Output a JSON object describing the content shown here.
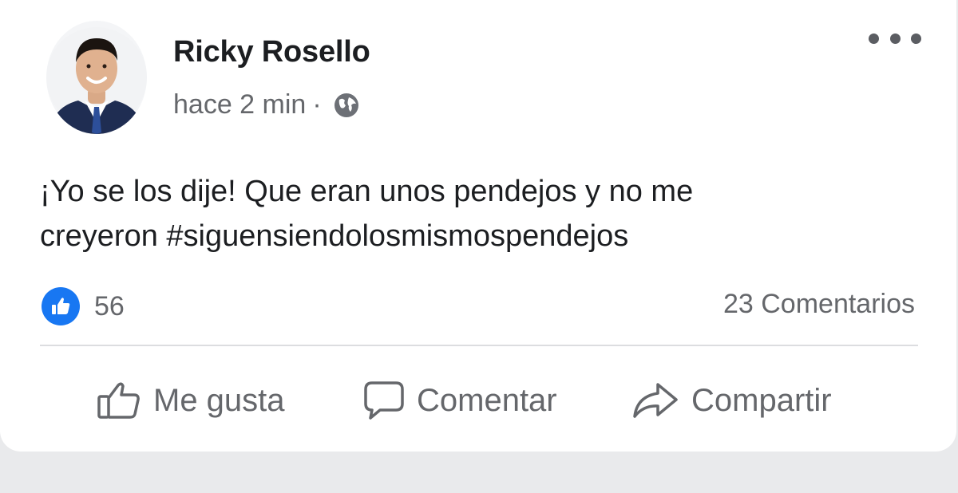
{
  "post": {
    "author": "Ricky Rosello",
    "time": "hace 2 min",
    "separator": "·",
    "visibility_icon": "globe-icon",
    "text": "¡Yo se los dije!  Que eran unos pendejos y no me\ncreyeron #siguensiendolosmismospendejos",
    "reactions": {
      "icon": "like-icon",
      "count": "56"
    },
    "comments": "23 Comentarios"
  },
  "actions": {
    "like": "Me gusta",
    "comment": "Comentar",
    "share": "Compartir"
  },
  "colors": {
    "like_blue": "#1877f2",
    "secondary_text": "#65676b",
    "primary_text": "#1c1e21"
  }
}
